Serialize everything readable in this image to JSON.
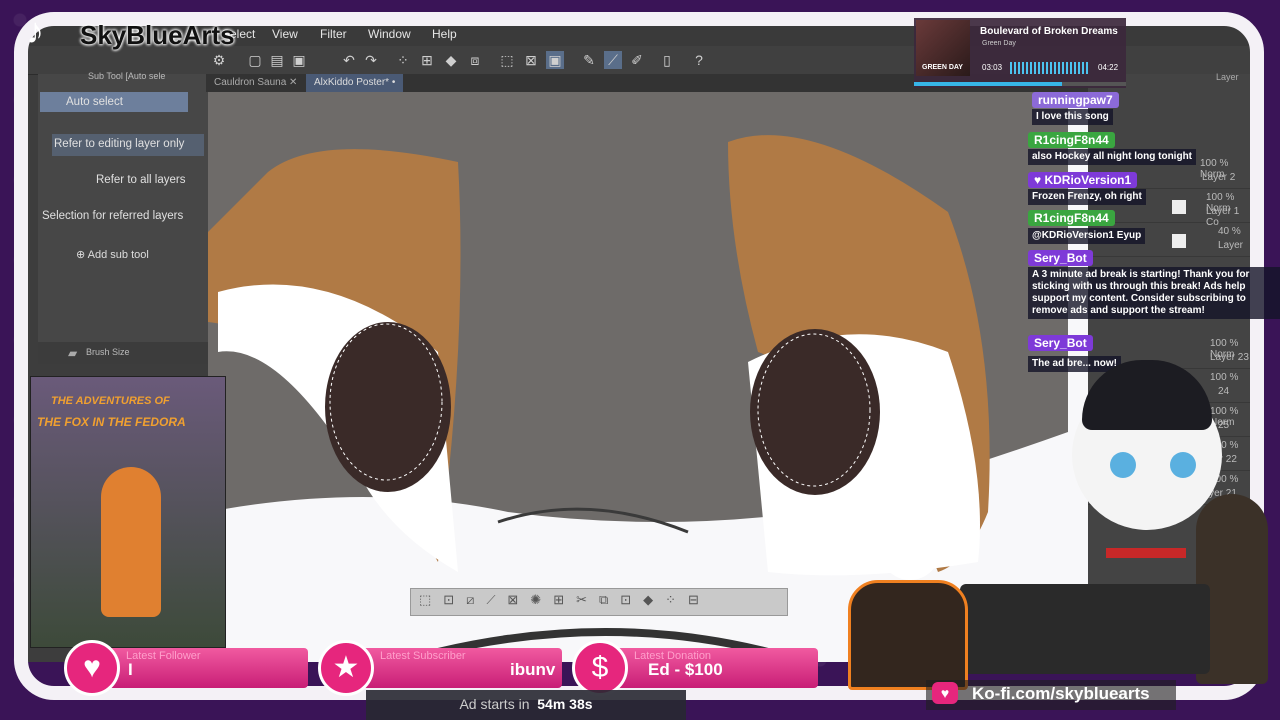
{
  "brand": {
    "tiktok_name": "SkyBlueArts"
  },
  "menu": [
    "Select",
    "View",
    "Filter",
    "Window",
    "Help"
  ],
  "subtool": {
    "title": "Sub Tool [Auto sele",
    "options": [
      "Auto select",
      "Refer to editing layer only",
      "Refer to all layers",
      "Selection for referred layers"
    ],
    "add_label": "Add sub tool",
    "brush_size_label": "Brush Size"
  },
  "tabs": [
    "Cauldron Sauna",
    "AlxKiddo Poster*"
  ],
  "music": {
    "title": "Boulevard of Broken Dreams",
    "artist": "Green Day",
    "album_text": "GREEN DAY",
    "elapsed": "03:03",
    "total": "04:22",
    "progress": 0.7
  },
  "layers": {
    "header": "Layer",
    "rows": [
      {
        "pct": "100 % Norm",
        "name": "Layer 2"
      },
      {
        "pct": "100 % Norm",
        "name": "Layer 1 Co"
      },
      {
        "pct": "40 %",
        "name": "Layer"
      },
      {
        "pct": "100 % Norm",
        "name": "Layer 23"
      },
      {
        "pct": "100 %",
        "name": "24"
      },
      {
        "pct": "100 % Norm",
        "name": "25"
      },
      {
        "pct": "100 %",
        "name": "Layer 22"
      },
      {
        "pct": "100 %",
        "name": "Layer 21"
      }
    ]
  },
  "chat": [
    {
      "name": "runningpaw7",
      "name_color": "#8c6ad8",
      "message": "I love this song"
    },
    {
      "name": "R1cingF8n44",
      "name_color": "#3aa640",
      "message": "also Hockey all night long tonight"
    },
    {
      "name": "KDRioVersion1",
      "name_color": "#7e3ad8",
      "message": "Frozen Frenzy, oh right"
    },
    {
      "name": "R1cingF8n44",
      "name_color": "#3aa640",
      "message": "@KDRioVersion1 Eyup"
    },
    {
      "name": "Sery_Bot",
      "name_color": "#7e3ad8",
      "message": "A 3 minute ad break is starting! Thank you for sticking with us through this break! Ads help support my content. Consider subscribing to remove ads and support the stream!"
    },
    {
      "name": "Sery_Bot",
      "name_color": "#7e3ad8",
      "message": "The ad bre... now!"
    }
  ],
  "poster": {
    "line1": "THE ADVENTURES OF",
    "line2": "THE FOX IN THE FEDORA"
  },
  "stats": {
    "follower": {
      "label": "Latest Follower",
      "value": "I"
    },
    "subscriber": {
      "label": "Latest Subscriber",
      "value": "ibunv"
    },
    "donation": {
      "label": "Latest Donation",
      "value": "Ed - $100"
    }
  },
  "ad_timer": {
    "label": "Ad starts in",
    "value": "54m 38s"
  },
  "kofi": {
    "text": "Ko-fi.com/skybluearts"
  },
  "colors": {
    "accent_pink": "#e6267d",
    "frame_purple": "#3a1457",
    "fur_brown": "#b07a45",
    "fur_gray": "#6e6b69"
  }
}
